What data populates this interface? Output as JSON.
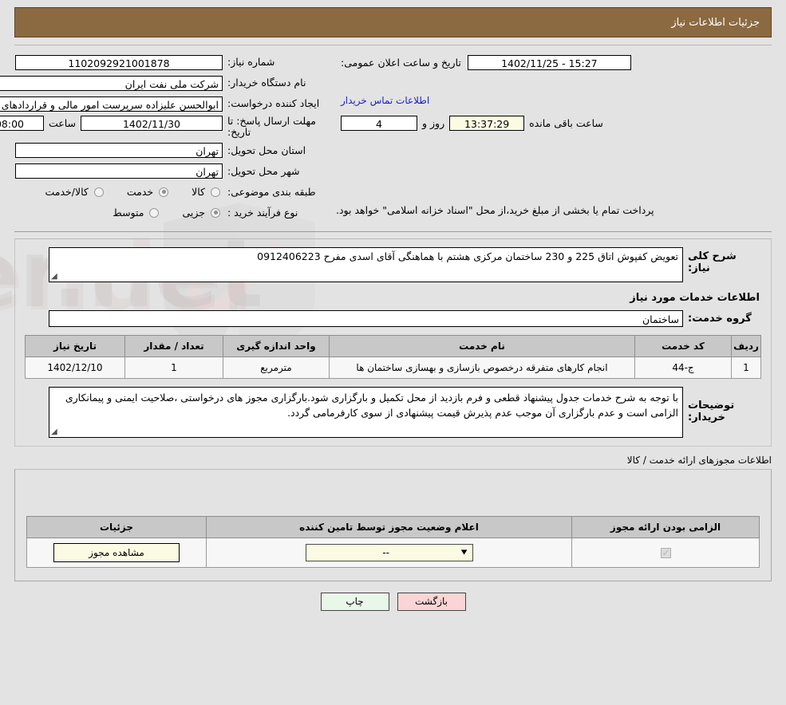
{
  "header": {
    "title": "جزئیات اطلاعات نیاز"
  },
  "colors": {
    "header_bar": "#8b6a42",
    "table_header": "#c8c8c8",
    "cream_field": "#fbfbe4",
    "print_button": "#e9f7e9",
    "back_button": "#fbd5d5",
    "link": "#2020c0"
  },
  "summary": {
    "need_number_label": "شماره نیاز:",
    "need_number_value": "1102092921001878",
    "buyer_org_label": "نام دستگاه خریدار:",
    "buyer_org_value": "شرکت ملی نفت ایران",
    "requester_label": "ایجاد کننده درخواست:",
    "requester_value": "ابوالحسن علیزاده سرپرست امور مالی و قراردادهای خدمات فنی تخصصی شرکت",
    "contact_link": "اطلاعات تماس خریدار",
    "deadline_label": "مهلت ارسال پاسخ: تا تاریخ:",
    "deadline_date": "1402/11/30",
    "deadline_time_label": "ساعت",
    "deadline_time": "08:00",
    "province_label": "استان محل تحویل:",
    "province_value": "تهران",
    "city_label": "شهر محل تحویل:",
    "city_value": "تهران",
    "public_announce_label": "تاریخ و ساعت اعلان عمومی:",
    "public_announce_value": "15:27 - 1402/11/25",
    "remaining_days": "4",
    "remaining_days_label": "روز و",
    "remaining_time": "13:37:29",
    "remaining_suffix": "ساعت باقی مانده",
    "category_label": "طبقه بندی موضوعی:",
    "category_options": [
      {
        "label": "کالا",
        "selected": false
      },
      {
        "label": "خدمت",
        "selected": true
      },
      {
        "label": "کالا/خدمت",
        "selected": false
      }
    ],
    "process_label": "نوع فرآیند خرید :",
    "process_options": [
      {
        "label": "جزیی",
        "selected": true
      },
      {
        "label": "متوسط",
        "selected": false
      }
    ],
    "payment_note": "پرداخت تمام یا بخشی از مبلغ خرید،از محل \"اسناد خزانه اسلامی\" خواهد بود."
  },
  "description": {
    "label": "شرح کلی نیاز:",
    "value": "تعویض کفپوش اتاق 225 و 230 ساختمان مرکزی هشتم  با هماهنگی آقای اسدی مفرح 0912406223"
  },
  "services": {
    "section_title": "اطلاعات خدمات مورد نیاز",
    "group_label": "گروه خدمت:",
    "group_value": "ساختمان",
    "columns": [
      "ردیف",
      "کد خدمت",
      "نام خدمت",
      "واحد اندازه گیری",
      "تعداد / مقدار",
      "تاریخ نیاز"
    ],
    "rows": [
      {
        "index": "1",
        "code": "ج-44",
        "name": "انجام کارهای متفرقه درخصوص بازسازی و بهسازی ساختمان ها",
        "unit": "مترمربع",
        "quantity": "1",
        "need_date": "1402/12/10"
      }
    ]
  },
  "buyer_notes": {
    "label": "توضیحات خریدار:",
    "value": "با توجه به شرح خدمات جدول پیشنهاد قطعی و فرم بازدید از محل تکمیل و بارگزاری شود.بارگزاری مجوز های درخواستی ،صلاحیت ایمنی و پیمانکاری الزامی است و عدم بارگزاری آن موجب عدم پذیرش قیمت پیشنهادی  از سوی کارفرمامی گردد."
  },
  "permits": {
    "caption": "اطلاعات مجوزهای ارائه خدمت / کالا",
    "columns": [
      "الزامی بودن ارائه مجوز",
      "اعلام وضعیت مجوز توسط تامین کننده",
      "جزئیات"
    ],
    "rows": [
      {
        "required": true,
        "status_value": "--",
        "details_button": "مشاهده مجوز"
      }
    ]
  },
  "footer": {
    "print_label": "چاپ",
    "back_label": "بازگشت"
  },
  "watermark": {
    "text": "AnaTender.net"
  }
}
